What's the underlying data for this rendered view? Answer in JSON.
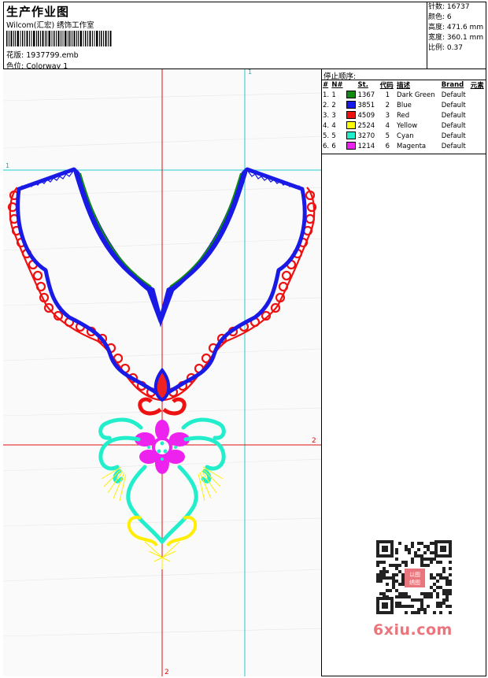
{
  "header": {
    "title": "生产作业图",
    "subtitle": "Wilcom(汇宏) 绣饰工作室",
    "design_label": "花版:",
    "design_value": "1937799.emb",
    "colorway_label": "色位:",
    "colorway_value": "Colorway 1"
  },
  "specs": [
    {
      "label": "针数:",
      "value": "16737"
    },
    {
      "label": "颜色:",
      "value": "6"
    },
    {
      "label": "高度:",
      "value": "471.6 mm"
    },
    {
      "label": "宽度:",
      "value": "360.1 mm"
    },
    {
      "label": "比例:",
      "value": "0.37"
    }
  ],
  "stop_sequence": {
    "title": "停止顺序:",
    "columns": [
      "#",
      "N#",
      "St.",
      "代码",
      "描述",
      "Brand",
      "元素"
    ],
    "rows": [
      {
        "num": "1.",
        "n": "1",
        "color": "#118811",
        "st": "1367",
        "code": "1",
        "desc": "Dark Green",
        "brand": "Default"
      },
      {
        "num": "2.",
        "n": "2",
        "color": "#1a1ae6",
        "st": "3851",
        "code": "2",
        "desc": "Blue",
        "brand": "Default"
      },
      {
        "num": "3.",
        "n": "3",
        "color": "#ee1111",
        "st": "4509",
        "code": "3",
        "desc": "Red",
        "brand": "Default"
      },
      {
        "num": "4.",
        "n": "4",
        "color": "#ffff00",
        "st": "2524",
        "code": "4",
        "desc": "Yellow",
        "brand": "Default"
      },
      {
        "num": "5.",
        "n": "5",
        "color": "#22eecc",
        "st": "3270",
        "code": "5",
        "desc": "Cyan",
        "brand": "Default"
      },
      {
        "num": "6.",
        "n": "6",
        "color": "#ee22ee",
        "st": "1214",
        "code": "6",
        "desc": "Magenta",
        "brand": "Default"
      }
    ]
  },
  "guides": {
    "v_cyan": "1",
    "h_cyan": "1",
    "h_red": "2",
    "v_red": "2"
  },
  "watermark": {
    "site": "6xiu.com",
    "stamp": "以图绣图"
  }
}
